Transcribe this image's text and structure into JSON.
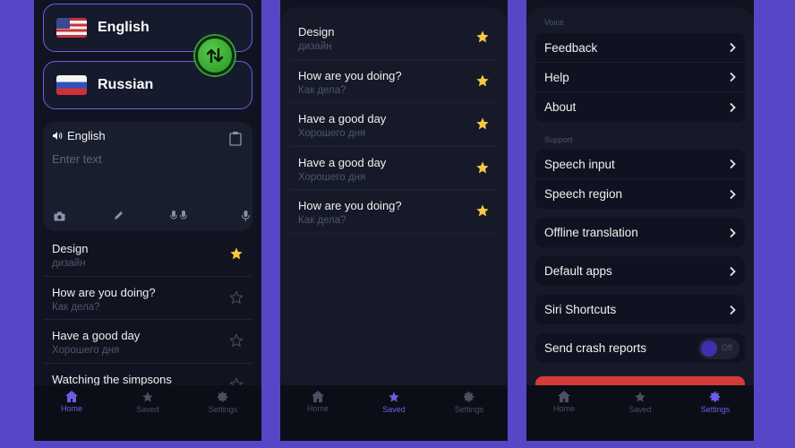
{
  "home": {
    "source_language": "English",
    "target_language": "Russian",
    "input_language_label": "English",
    "input_placeholder": "Enter text",
    "recent": [
      {
        "en": "Design",
        "ru": "дизайн",
        "starred": true
      },
      {
        "en": "How are you doing?",
        "ru": "Как дела?",
        "starred": false
      },
      {
        "en": "Have a good day",
        "ru": "Хорошего дня",
        "starred": false
      },
      {
        "en": "Watching the simpsons",
        "ru": "",
        "starred": false
      }
    ]
  },
  "saved": {
    "items": [
      {
        "en": "Design",
        "ru": "дизайн"
      },
      {
        "en": "How are you doing?",
        "ru": "Как дела?"
      },
      {
        "en": "Have a good day",
        "ru": "Хорошего дня"
      },
      {
        "en": "Have a good day",
        "ru": "Хорошего дня"
      },
      {
        "en": "How are you doing?",
        "ru": "Как дела?"
      }
    ]
  },
  "settings": {
    "section_voice": "Voice",
    "voice_items": [
      "Feedback",
      "Help",
      "About"
    ],
    "section_support": "Support",
    "support_items": [
      "Speech input",
      "Speech region"
    ],
    "offline_translation": "Offline translation",
    "default_apps": "Default apps",
    "siri_shortcuts": "Siri Shortcuts",
    "send_crash_reports": "Send crash reports",
    "toggle_state": "Off"
  },
  "tabs": {
    "home": "Home",
    "saved": "Saved",
    "settings": "Settings"
  },
  "colors": {
    "accent": "#6e5de6",
    "star": "#f5c842",
    "background": "#5547c6",
    "swap_button": "#2fa52a",
    "danger": "#d43a3a"
  }
}
